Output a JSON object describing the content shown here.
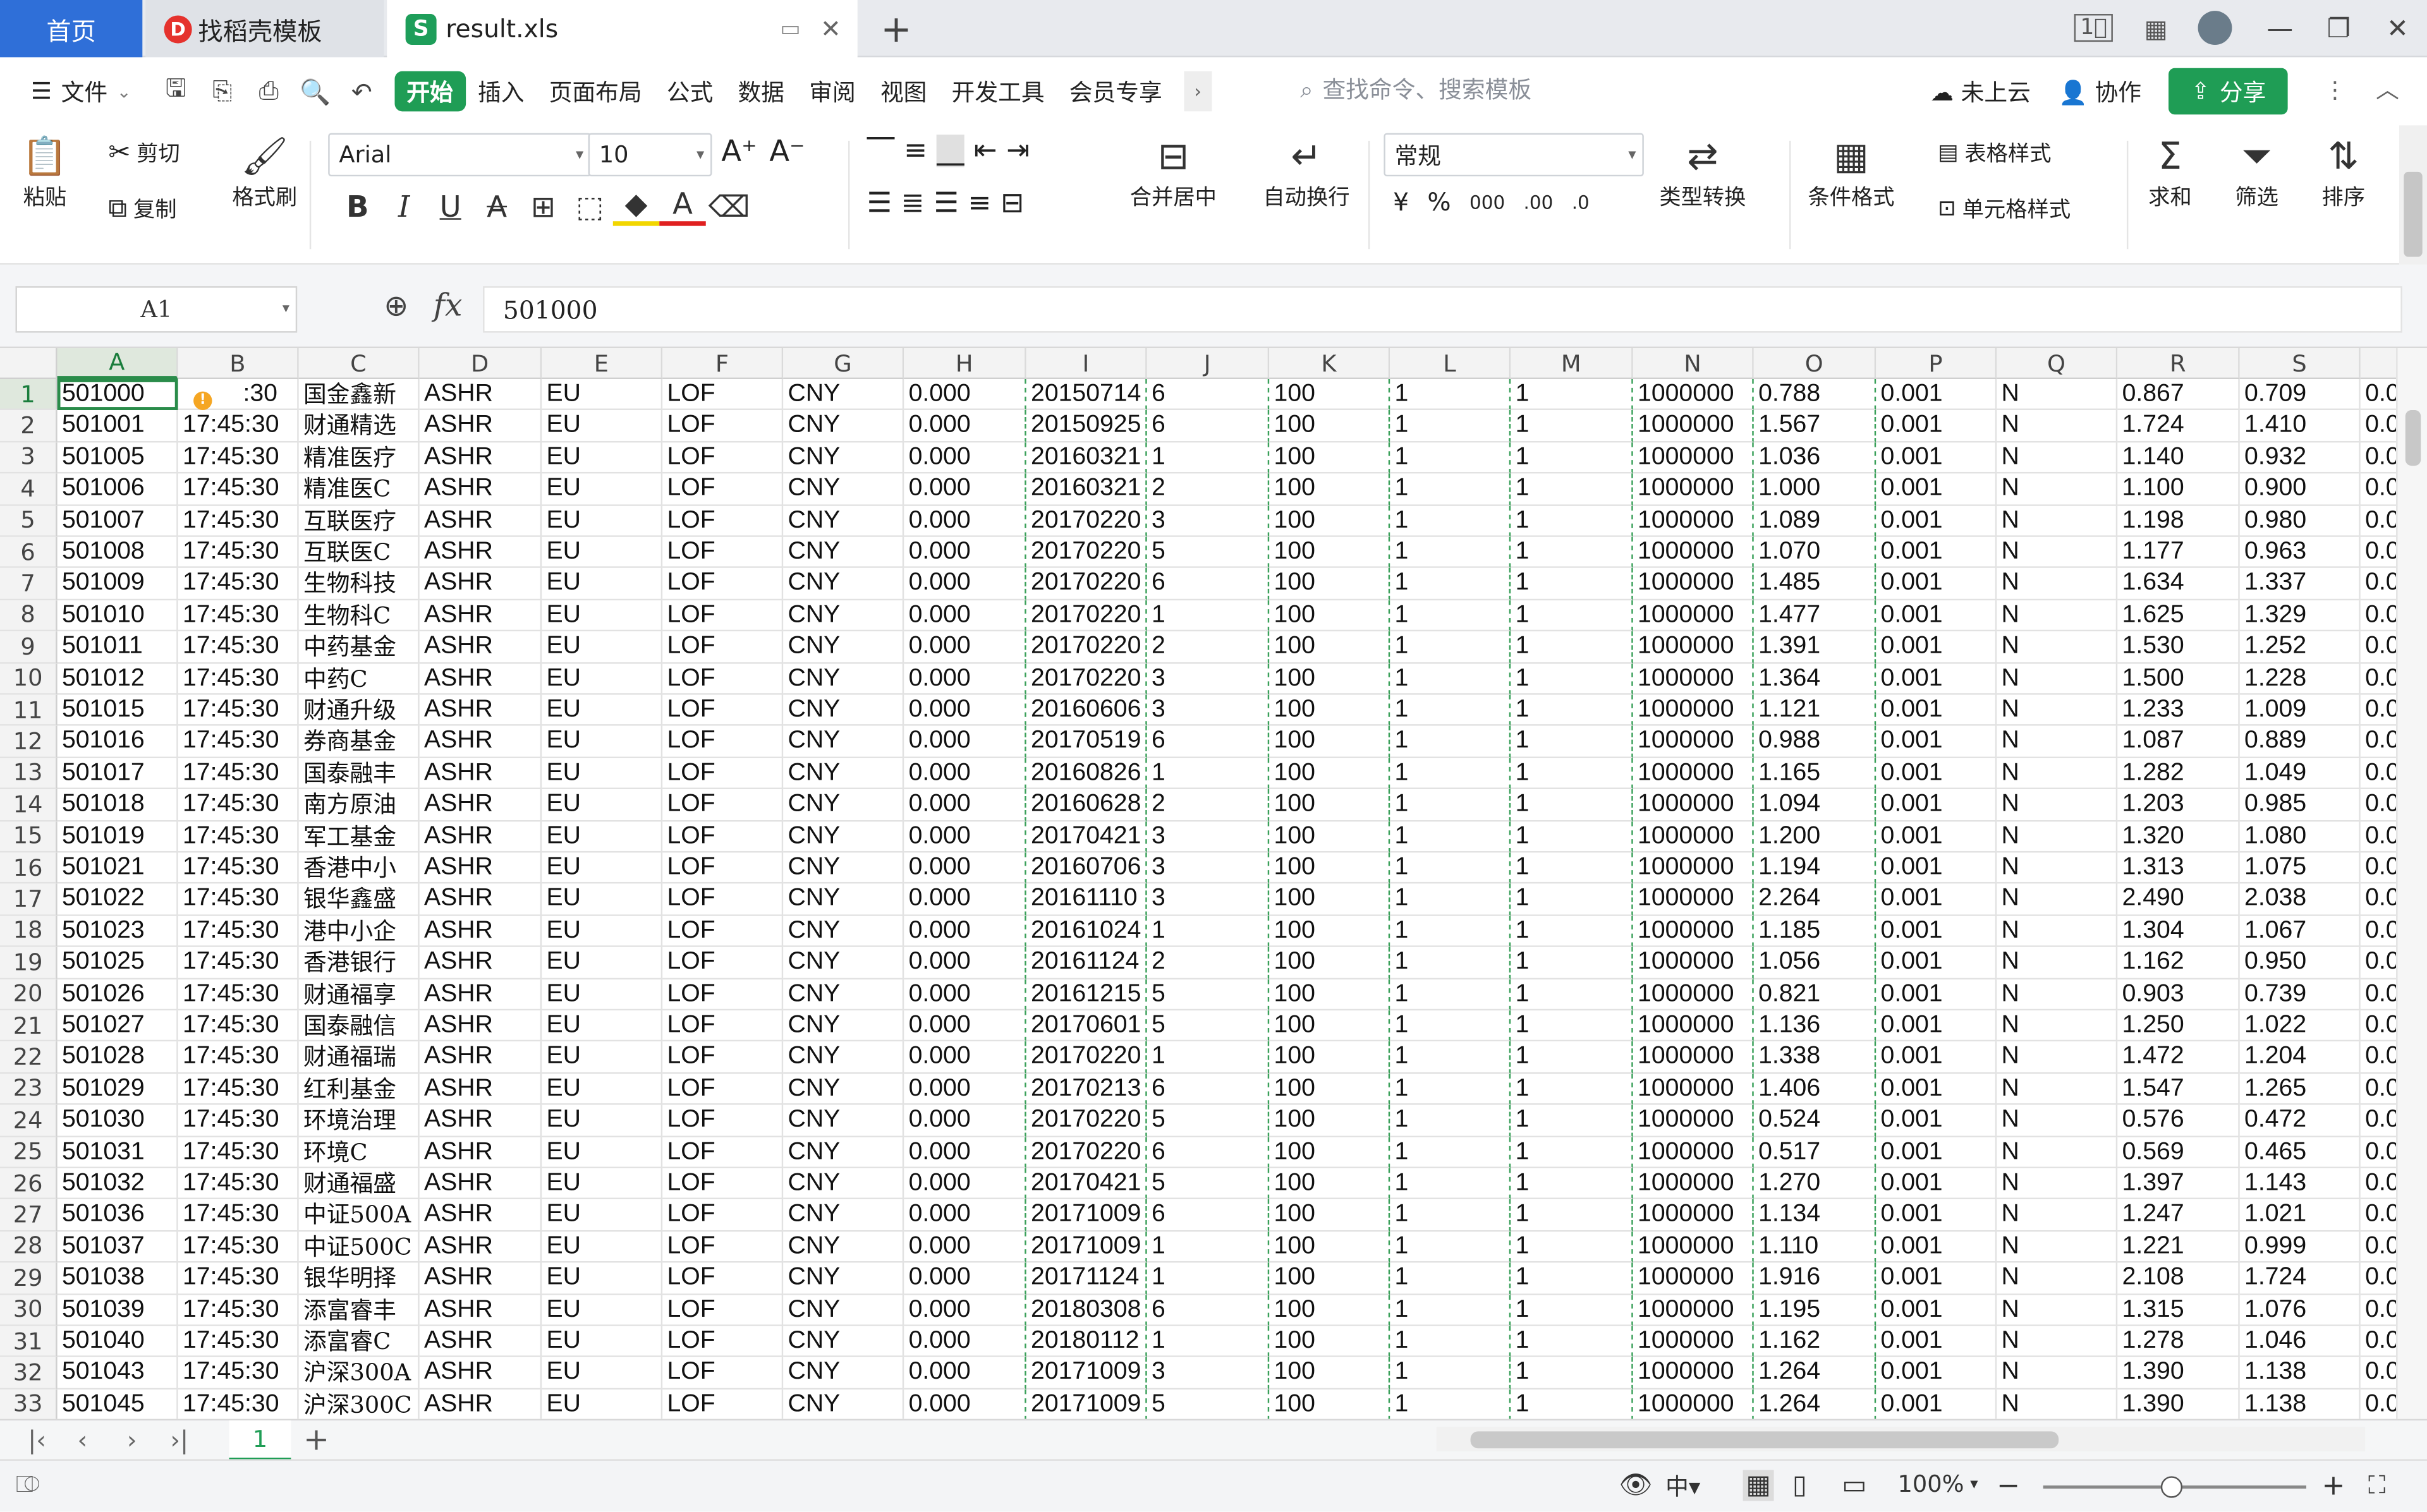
{
  "tabs": {
    "home": "首页",
    "docer": "找稻壳模板",
    "file": "result.xls",
    "add": "+"
  },
  "window": {
    "minimize": "—",
    "restore": "❐",
    "close": "✕"
  },
  "menu": {
    "file": "文件",
    "items": [
      "开始",
      "插入",
      "页面布局",
      "公式",
      "数据",
      "审阅",
      "视图",
      "开发工具",
      "会员专享"
    ],
    "search_placeholder": "查找命令、搜索模板",
    "cloud": "未上云",
    "collab": "协作",
    "share": "分享"
  },
  "ribbon": {
    "paste": "粘贴",
    "cut": "剪切",
    "copy": "复制",
    "format_painter": "格式刷",
    "font": "Arial",
    "font_size": "10",
    "merge_center": "合并居中",
    "wrap": "自动换行",
    "number_format": "常规",
    "type_convert": "类型转换",
    "cond_format": "条件格式",
    "table_style": "表格样式",
    "cell_style": "单元格样式",
    "sum": "求和",
    "filter": "筛选",
    "sort": "排序"
  },
  "formula_bar": {
    "name_box": "A1",
    "fx": "fx",
    "value": "501000"
  },
  "columns": [
    "A",
    "B",
    "C",
    "D",
    "E",
    "F",
    "G",
    "H",
    "I",
    "J",
    "K",
    "L",
    "M",
    "N",
    "O",
    "P",
    "Q",
    "R",
    "S",
    ""
  ],
  "rows": [
    [
      "501000",
      ":30",
      "国金鑫新",
      "ASHR",
      "EU",
      "LOF",
      "CNY",
      "0.000",
      "20150714",
      "6",
      "100",
      "1",
      "1",
      "1000000",
      "0.788",
      "0.001",
      "N",
      "0.867",
      "0.709",
      "0.0"
    ],
    [
      "501001",
      "17:45:30",
      "财通精选",
      "ASHR",
      "EU",
      "LOF",
      "CNY",
      "0.000",
      "20150925",
      "6",
      "100",
      "1",
      "1",
      "1000000",
      "1.567",
      "0.001",
      "N",
      "1.724",
      "1.410",
      "0.0"
    ],
    [
      "501005",
      "17:45:30",
      "精准医疗",
      "ASHR",
      "EU",
      "LOF",
      "CNY",
      "0.000",
      "20160321",
      "1",
      "100",
      "1",
      "1",
      "1000000",
      "1.036",
      "0.001",
      "N",
      "1.140",
      "0.932",
      "0.0"
    ],
    [
      "501006",
      "17:45:30",
      "精准医C",
      "ASHR",
      "EU",
      "LOF",
      "CNY",
      "0.000",
      "20160321",
      "2",
      "100",
      "1",
      "1",
      "1000000",
      "1.000",
      "0.001",
      "N",
      "1.100",
      "0.900",
      "0.0"
    ],
    [
      "501007",
      "17:45:30",
      "互联医疗",
      "ASHR",
      "EU",
      "LOF",
      "CNY",
      "0.000",
      "20170220",
      "3",
      "100",
      "1",
      "1",
      "1000000",
      "1.089",
      "0.001",
      "N",
      "1.198",
      "0.980",
      "0.0"
    ],
    [
      "501008",
      "17:45:30",
      "互联医C",
      "ASHR",
      "EU",
      "LOF",
      "CNY",
      "0.000",
      "20170220",
      "5",
      "100",
      "1",
      "1",
      "1000000",
      "1.070",
      "0.001",
      "N",
      "1.177",
      "0.963",
      "0.0"
    ],
    [
      "501009",
      "17:45:30",
      "生物科技",
      "ASHR",
      "EU",
      "LOF",
      "CNY",
      "0.000",
      "20170220",
      "6",
      "100",
      "1",
      "1",
      "1000000",
      "1.485",
      "0.001",
      "N",
      "1.634",
      "1.337",
      "0.0"
    ],
    [
      "501010",
      "17:45:30",
      "生物科C",
      "ASHR",
      "EU",
      "LOF",
      "CNY",
      "0.000",
      "20170220",
      "1",
      "100",
      "1",
      "1",
      "1000000",
      "1.477",
      "0.001",
      "N",
      "1.625",
      "1.329",
      "0.0"
    ],
    [
      "501011",
      "17:45:30",
      "中药基金",
      "ASHR",
      "EU",
      "LOF",
      "CNY",
      "0.000",
      "20170220",
      "2",
      "100",
      "1",
      "1",
      "1000000",
      "1.391",
      "0.001",
      "N",
      "1.530",
      "1.252",
      "0.0"
    ],
    [
      "501012",
      "17:45:30",
      "中药C",
      "ASHR",
      "EU",
      "LOF",
      "CNY",
      "0.000",
      "20170220",
      "3",
      "100",
      "1",
      "1",
      "1000000",
      "1.364",
      "0.001",
      "N",
      "1.500",
      "1.228",
      "0.0"
    ],
    [
      "501015",
      "17:45:30",
      "财通升级",
      "ASHR",
      "EU",
      "LOF",
      "CNY",
      "0.000",
      "20160606",
      "3",
      "100",
      "1",
      "1",
      "1000000",
      "1.121",
      "0.001",
      "N",
      "1.233",
      "1.009",
      "0.0"
    ],
    [
      "501016",
      "17:45:30",
      "券商基金",
      "ASHR",
      "EU",
      "LOF",
      "CNY",
      "0.000",
      "20170519",
      "6",
      "100",
      "1",
      "1",
      "1000000",
      "0.988",
      "0.001",
      "N",
      "1.087",
      "0.889",
      "0.0"
    ],
    [
      "501017",
      "17:45:30",
      "国泰融丰",
      "ASHR",
      "EU",
      "LOF",
      "CNY",
      "0.000",
      "20160826",
      "1",
      "100",
      "1",
      "1",
      "1000000",
      "1.165",
      "0.001",
      "N",
      "1.282",
      "1.049",
      "0.0"
    ],
    [
      "501018",
      "17:45:30",
      "南方原油",
      "ASHR",
      "EU",
      "LOF",
      "CNY",
      "0.000",
      "20160628",
      "2",
      "100",
      "1",
      "1",
      "1000000",
      "1.094",
      "0.001",
      "N",
      "1.203",
      "0.985",
      "0.0"
    ],
    [
      "501019",
      "17:45:30",
      "军工基金",
      "ASHR",
      "EU",
      "LOF",
      "CNY",
      "0.000",
      "20170421",
      "3",
      "100",
      "1",
      "1",
      "1000000",
      "1.200",
      "0.001",
      "N",
      "1.320",
      "1.080",
      "0.0"
    ],
    [
      "501021",
      "17:45:30",
      "香港中小",
      "ASHR",
      "EU",
      "LOF",
      "CNY",
      "0.000",
      "20160706",
      "3",
      "100",
      "1",
      "1",
      "1000000",
      "1.194",
      "0.001",
      "N",
      "1.313",
      "1.075",
      "0.0"
    ],
    [
      "501022",
      "17:45:30",
      "银华鑫盛",
      "ASHR",
      "EU",
      "LOF",
      "CNY",
      "0.000",
      "20161110",
      "3",
      "100",
      "1",
      "1",
      "1000000",
      "2.264",
      "0.001",
      "N",
      "2.490",
      "2.038",
      "0.0"
    ],
    [
      "501023",
      "17:45:30",
      "港中小企",
      "ASHR",
      "EU",
      "LOF",
      "CNY",
      "0.000",
      "20161024",
      "1",
      "100",
      "1",
      "1",
      "1000000",
      "1.185",
      "0.001",
      "N",
      "1.304",
      "1.067",
      "0.0"
    ],
    [
      "501025",
      "17:45:30",
      "香港银行",
      "ASHR",
      "EU",
      "LOF",
      "CNY",
      "0.000",
      "20161124",
      "2",
      "100",
      "1",
      "1",
      "1000000",
      "1.056",
      "0.001",
      "N",
      "1.162",
      "0.950",
      "0.0"
    ],
    [
      "501026",
      "17:45:30",
      "财通福享",
      "ASHR",
      "EU",
      "LOF",
      "CNY",
      "0.000",
      "20161215",
      "5",
      "100",
      "1",
      "1",
      "1000000",
      "0.821",
      "0.001",
      "N",
      "0.903",
      "0.739",
      "0.0"
    ],
    [
      "501027",
      "17:45:30",
      "国泰融信",
      "ASHR",
      "EU",
      "LOF",
      "CNY",
      "0.000",
      "20170601",
      "5",
      "100",
      "1",
      "1",
      "1000000",
      "1.136",
      "0.001",
      "N",
      "1.250",
      "1.022",
      "0.0"
    ],
    [
      "501028",
      "17:45:30",
      "财通福瑞",
      "ASHR",
      "EU",
      "LOF",
      "CNY",
      "0.000",
      "20170220",
      "1",
      "100",
      "1",
      "1",
      "1000000",
      "1.338",
      "0.001",
      "N",
      "1.472",
      "1.204",
      "0.0"
    ],
    [
      "501029",
      "17:45:30",
      "红利基金",
      "ASHR",
      "EU",
      "LOF",
      "CNY",
      "0.000",
      "20170213",
      "6",
      "100",
      "1",
      "1",
      "1000000",
      "1.406",
      "0.001",
      "N",
      "1.547",
      "1.265",
      "0.0"
    ],
    [
      "501030",
      "17:45:30",
      "环境治理",
      "ASHR",
      "EU",
      "LOF",
      "CNY",
      "0.000",
      "20170220",
      "5",
      "100",
      "1",
      "1",
      "1000000",
      "0.524",
      "0.001",
      "N",
      "0.576",
      "0.472",
      "0.0"
    ],
    [
      "501031",
      "17:45:30",
      "环境C",
      "ASHR",
      "EU",
      "LOF",
      "CNY",
      "0.000",
      "20170220",
      "6",
      "100",
      "1",
      "1",
      "1000000",
      "0.517",
      "0.001",
      "N",
      "0.569",
      "0.465",
      "0.0"
    ],
    [
      "501032",
      "17:45:30",
      "财通福盛",
      "ASHR",
      "EU",
      "LOF",
      "CNY",
      "0.000",
      "20170421",
      "5",
      "100",
      "1",
      "1",
      "1000000",
      "1.270",
      "0.001",
      "N",
      "1.397",
      "1.143",
      "0.0"
    ],
    [
      "501036",
      "17:45:30",
      "中证500A",
      "ASHR",
      "EU",
      "LOF",
      "CNY",
      "0.000",
      "20171009",
      "6",
      "100",
      "1",
      "1",
      "1000000",
      "1.134",
      "0.001",
      "N",
      "1.247",
      "1.021",
      "0.0"
    ],
    [
      "501037",
      "17:45:30",
      "中证500C",
      "ASHR",
      "EU",
      "LOF",
      "CNY",
      "0.000",
      "20171009",
      "1",
      "100",
      "1",
      "1",
      "1000000",
      "1.110",
      "0.001",
      "N",
      "1.221",
      "0.999",
      "0.0"
    ],
    [
      "501038",
      "17:45:30",
      "银华明择",
      "ASHR",
      "EU",
      "LOF",
      "CNY",
      "0.000",
      "20171124",
      "1",
      "100",
      "1",
      "1",
      "1000000",
      "1.916",
      "0.001",
      "N",
      "2.108",
      "1.724",
      "0.0"
    ],
    [
      "501039",
      "17:45:30",
      "添富睿丰",
      "ASHR",
      "EU",
      "LOF",
      "CNY",
      "0.000",
      "20180308",
      "6",
      "100",
      "1",
      "1",
      "1000000",
      "1.195",
      "0.001",
      "N",
      "1.315",
      "1.076",
      "0.0"
    ],
    [
      "501040",
      "17:45:30",
      "添富睿C",
      "ASHR",
      "EU",
      "LOF",
      "CNY",
      "0.000",
      "20180112",
      "1",
      "100",
      "1",
      "1",
      "1000000",
      "1.162",
      "0.001",
      "N",
      "1.278",
      "1.046",
      "0.0"
    ],
    [
      "501043",
      "17:45:30",
      "沪深300A",
      "ASHR",
      "EU",
      "LOF",
      "CNY",
      "0.000",
      "20171009",
      "3",
      "100",
      "1",
      "1",
      "1000000",
      "1.264",
      "0.001",
      "N",
      "1.390",
      "1.138",
      "0.0"
    ],
    [
      "501045",
      "17:45:30",
      "沪深300C",
      "ASHR",
      "EU",
      "LOF",
      "CNY",
      "0.000",
      "20171009",
      "5",
      "100",
      "1",
      "1",
      "1000000",
      "1.264",
      "0.001",
      "N",
      "1.390",
      "1.138",
      "0.0"
    ]
  ],
  "sheet": {
    "tab": "1",
    "add": "+"
  },
  "status": {
    "zoom": "100%"
  },
  "colors": {
    "accent": "#1f9d55",
    "home_tab": "#2f6fd8",
    "selection": "#2a8c4a"
  }
}
